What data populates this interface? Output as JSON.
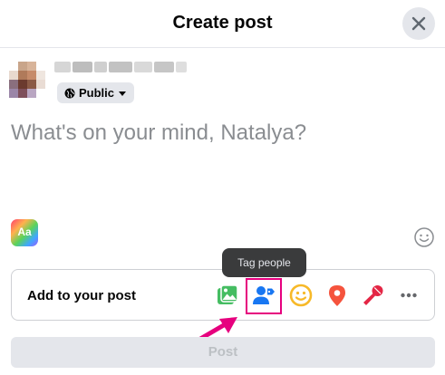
{
  "dialog": {
    "title": "Create post",
    "close_icon": "close-icon"
  },
  "author": {
    "privacy_label": "Public",
    "privacy_icon": "globe-icon",
    "dropdown_icon": "caret-down-icon"
  },
  "composer": {
    "placeholder": "What's on your mind, Natalya?"
  },
  "text_format": {
    "label": "Aa"
  },
  "tooltip": {
    "label": "Tag people"
  },
  "add_to_post": {
    "label": "Add to your post",
    "tools": [
      {
        "icon": "photo-video-icon",
        "color": "#45bd62"
      },
      {
        "icon": "tag-people-icon",
        "color": "#1877f2"
      },
      {
        "icon": "feeling-activity-icon",
        "color": "#f7b928"
      },
      {
        "icon": "check-in-icon",
        "color": "#f5533d"
      },
      {
        "icon": "live-video-icon",
        "color": "#e42645"
      },
      {
        "icon": "more-icon",
        "color": "#65676b"
      }
    ]
  },
  "annotation": {
    "highlight_color": "#e6007e"
  },
  "post_button": {
    "label": "Post"
  }
}
